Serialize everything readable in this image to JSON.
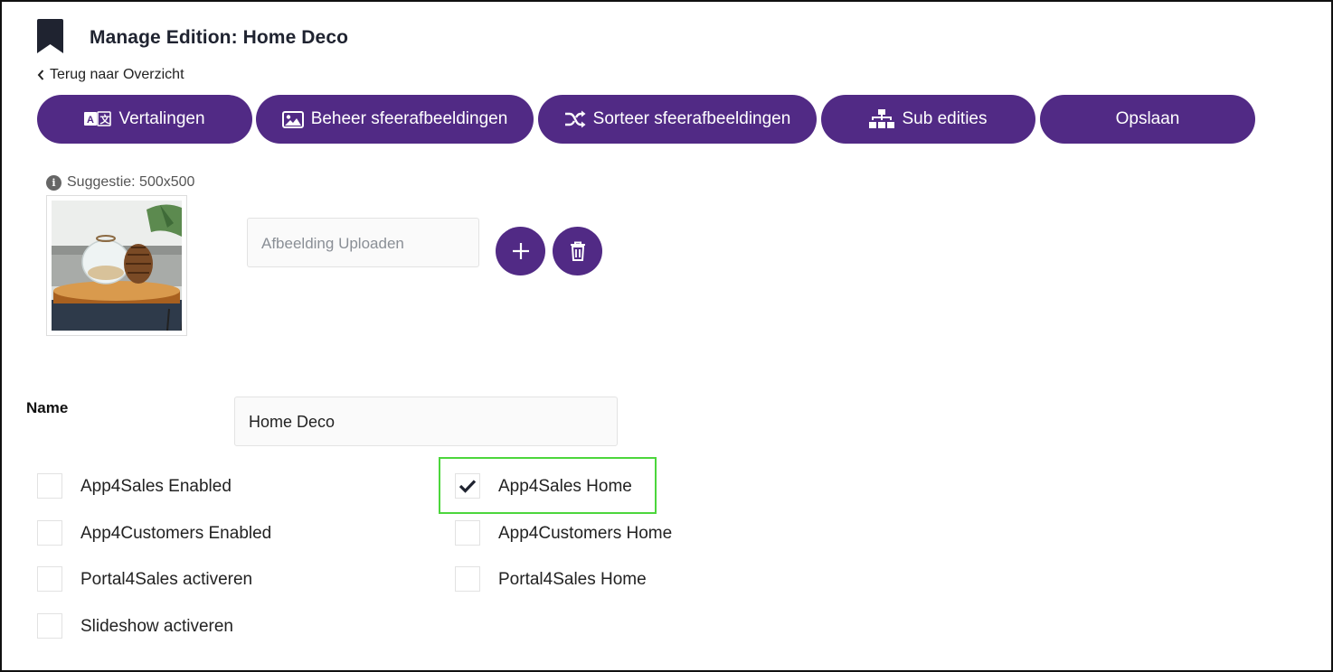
{
  "header": {
    "title": "Manage Edition: Home Deco",
    "back_link": "Terug naar Overzicht",
    "bookmark_icon": "bookmark-icon"
  },
  "toolbar": {
    "translations": {
      "label": "Vertalingen",
      "icon": "translate-icon"
    },
    "manage_images": {
      "label": "Beheer sfeerafbeeldingen",
      "icon": "image-icon"
    },
    "sort_images": {
      "label": "Sorteer sfeerafbeeldingen",
      "icon": "shuffle-icon"
    },
    "sub_editions": {
      "label": "Sub edities",
      "icon": "sitemap-icon"
    },
    "save": {
      "label": "Opslaan"
    }
  },
  "image_section": {
    "suggestion": "Suggestie: 500x500",
    "upload_placeholder": "Afbeelding Uploaden",
    "add_icon": "plus-icon",
    "delete_icon": "trash-icon"
  },
  "form": {
    "name_label": "Name",
    "name_value": "Home Deco",
    "checkboxes": [
      {
        "label": "App4Sales Enabled",
        "checked": false
      },
      {
        "label": "App4Sales Home",
        "checked": true
      },
      {
        "label": "App4Customers Enabled",
        "checked": false
      },
      {
        "label": "App4Customers Home",
        "checked": false
      },
      {
        "label": "Portal4Sales activeren",
        "checked": false
      },
      {
        "label": "Portal4Sales Home",
        "checked": false
      },
      {
        "label": "Slideshow activeren",
        "checked": false
      }
    ]
  },
  "colors": {
    "accent": "#512a85",
    "highlight": "#4cd63c"
  }
}
